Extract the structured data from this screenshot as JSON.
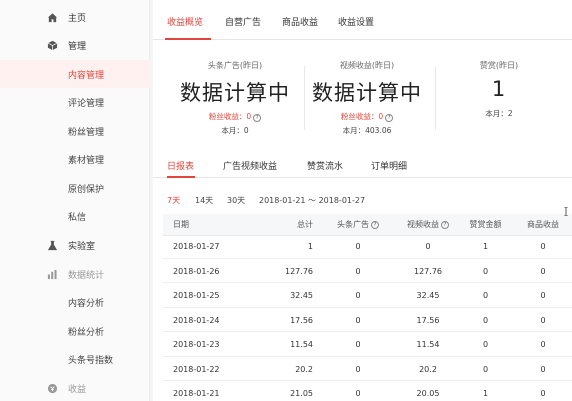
{
  "sidebar": {
    "items": [
      {
        "label": "主页",
        "icon": "home-icon"
      },
      {
        "label": "管理",
        "icon": "cube-icon"
      },
      {
        "label": "内容管理"
      },
      {
        "label": "评论管理"
      },
      {
        "label": "粉丝管理"
      },
      {
        "label": "素材管理"
      },
      {
        "label": "原创保护"
      },
      {
        "label": "私信"
      },
      {
        "label": "实验室",
        "icon": "flask-icon"
      },
      {
        "label": "数据统计",
        "icon": "bar-chart-icon"
      },
      {
        "label": "内容分析"
      },
      {
        "label": "粉丝分析"
      },
      {
        "label": "头条号指数"
      },
      {
        "label": "收益",
        "icon": "coin-icon"
      }
    ]
  },
  "tabs": [
    "收益概览",
    "自营广告",
    "商品收益",
    "收益设置"
  ],
  "stats": [
    {
      "title": "头条广告(昨日)",
      "value": "数据计算中",
      "fans": "粉丝收益：0",
      "month": "本月：0"
    },
    {
      "title": "视频收益(昨日)",
      "value": "数据计算中",
      "fans": "粉丝收益：0",
      "month": "本月：403.06"
    },
    {
      "title": "赞赏(昨日)",
      "value": "1",
      "month": "本月：2"
    }
  ],
  "sub_tabs": [
    "日报表",
    "广告视频收益",
    "赞赏流水",
    "订单明细"
  ],
  "filters": {
    "ranges": [
      "7天",
      "14天",
      "30天"
    ],
    "date_range": "2018-01-21 ～ 2018-01-27"
  },
  "table": {
    "headers": {
      "date": "日期",
      "total": "总计",
      "ad": "头条广告",
      "video": "视频收益",
      "praise": "赞赏金额",
      "goods": "商品收益"
    },
    "rows": [
      {
        "date": "2018-01-27",
        "total": "1",
        "ad": "0",
        "video": "0",
        "praise": "1",
        "goods": "0"
      },
      {
        "date": "2018-01-26",
        "total": "127.76",
        "ad": "0",
        "video": "127.76",
        "praise": "0",
        "goods": "0"
      },
      {
        "date": "2018-01-25",
        "total": "32.45",
        "ad": "0",
        "video": "32.45",
        "praise": "0",
        "goods": "0"
      },
      {
        "date": "2018-01-24",
        "total": "17.56",
        "ad": "0",
        "video": "17.56",
        "praise": "0",
        "goods": "0"
      },
      {
        "date": "2018-01-23",
        "total": "11.54",
        "ad": "0",
        "video": "11.54",
        "praise": "0",
        "goods": "0"
      },
      {
        "date": "2018-01-22",
        "total": "20.2",
        "ad": "0",
        "video": "20.2",
        "praise": "0",
        "goods": "0"
      },
      {
        "date": "2018-01-21",
        "total": "21.05",
        "ad": "0",
        "video": "20.05",
        "praise": "1",
        "goods": "0"
      }
    ]
  },
  "colors": {
    "accent": "#e0443a",
    "sidebar_bg": "#fafafa"
  }
}
